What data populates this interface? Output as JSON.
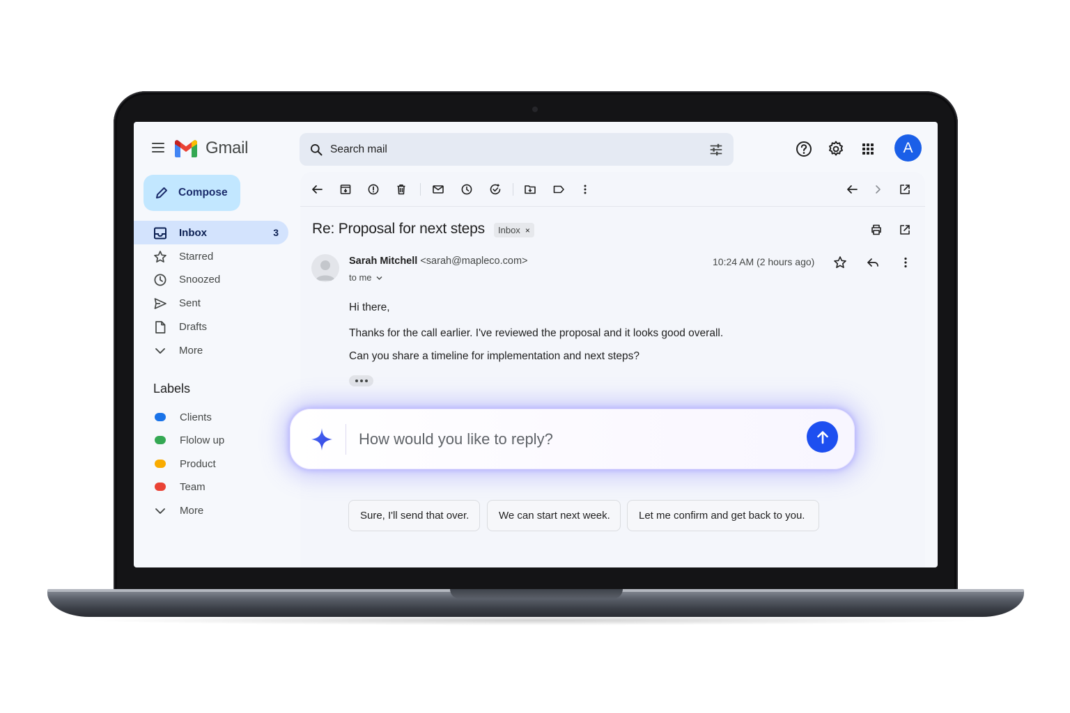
{
  "app": {
    "brand": "Gmail"
  },
  "search": {
    "placeholder": "Search mail"
  },
  "sidebar": {
    "compose_label": "Compose",
    "items": [
      {
        "label": "Inbox",
        "count": "3"
      },
      {
        "label": "Starred"
      },
      {
        "label": "Snoozed"
      },
      {
        "label": "Sent"
      },
      {
        "label": "Drafts"
      },
      {
        "label": "More"
      }
    ],
    "labels_title": "Labels",
    "labels": [
      {
        "label": "Clients",
        "color": "#1a73e8"
      },
      {
        "label": "Flolow up",
        "color": "#34a853"
      },
      {
        "label": "Product",
        "color": "#f9ab00"
      },
      {
        "label": "Team",
        "color": "#ea4335"
      },
      {
        "label": "More"
      }
    ]
  },
  "header": {
    "avatar_initial": "A",
    "avatar_color": "#1a5fe8"
  },
  "email": {
    "subject": "Re: Proposal for next steps",
    "label_chip": "Inbox",
    "chip_close": "×",
    "sender_name": "Sarah Mitchell",
    "sender_email": "<sarah@mapleco.com>",
    "to": "to me",
    "time": "10:24 AM (2 hours ago)",
    "body": [
      "Hi there,",
      "Thanks for the call earlier. I've reviewed the proposal and it looks good overall.",
      "Can you share a timeline for implementation and next steps?"
    ]
  },
  "reply": {
    "placeholder": "How would you like to reply?",
    "send_color": "#1d4ff0",
    "suggestions": [
      "Sure, I'll send that over.",
      "We can start next week.",
      "Let me confirm and get back to you."
    ]
  },
  "icons": {
    "topbar": [
      "menu-icon",
      "gmail-logo-icon",
      "search-icon",
      "tune-icon",
      "help-icon",
      "gear-icon",
      "apps-icon"
    ],
    "toolbar": [
      "back-arrow-icon",
      "archive-icon",
      "report-spam-icon",
      "delete-icon",
      "mark-unread-icon",
      "snooze-icon",
      "add-to-tasks-icon",
      "move-to-icon",
      "label-icon",
      "more-vert-icon",
      "newer-icon",
      "older-icon",
      "open-new-window-icon"
    ]
  }
}
